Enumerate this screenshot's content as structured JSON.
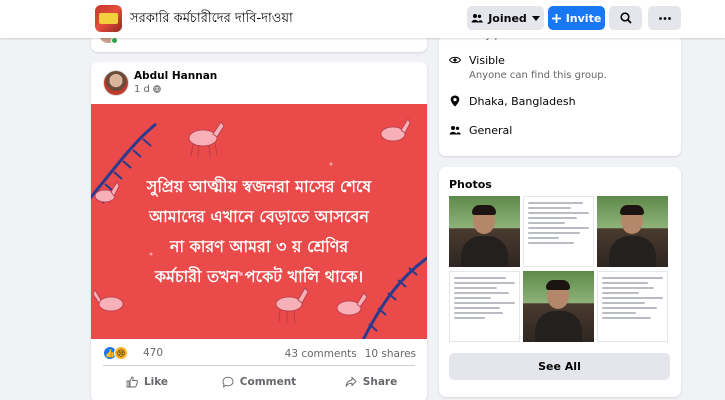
{
  "header": {
    "group_name": "সরকারি কর্মচারীদের দাবি-দাওয়া",
    "joined_label": "Joined",
    "invite_label": "Invite"
  },
  "previous_post": {
    "action_icons": [
      "comment-icon",
      "share-icon",
      "emoji-icon"
    ]
  },
  "post": {
    "author": "Abdul Hannan",
    "time": "1 d",
    "image_text": [
      "সুপ্রিয় আত্মীয় স্বজনরা মাসের শেষে",
      "আমাদের এখানে বেড়াতে আসবেন",
      "না কারণ আমরা ৩ য় শ্রেণির",
      "কর্মচারী তখন পকেট খালি থাকে।"
    ],
    "reaction_count": "470",
    "comments": "43 comments",
    "shares": "10 shares",
    "actions": {
      "like": "Like",
      "comment": "Comment",
      "share": "Share"
    },
    "image_bg": "#ea4a4a"
  },
  "about": {
    "top_partial": "they post.",
    "visible_title": "Visible",
    "visible_sub": "Anyone can find this group.",
    "location": "Dhaka, Bangladesh",
    "category": "General"
  },
  "photos": {
    "title": "Photos",
    "see_all": "See All"
  },
  "colors": {
    "accent": "#1877f2",
    "page_bg": "#f0f2f5",
    "muted_text": "#65676b"
  }
}
